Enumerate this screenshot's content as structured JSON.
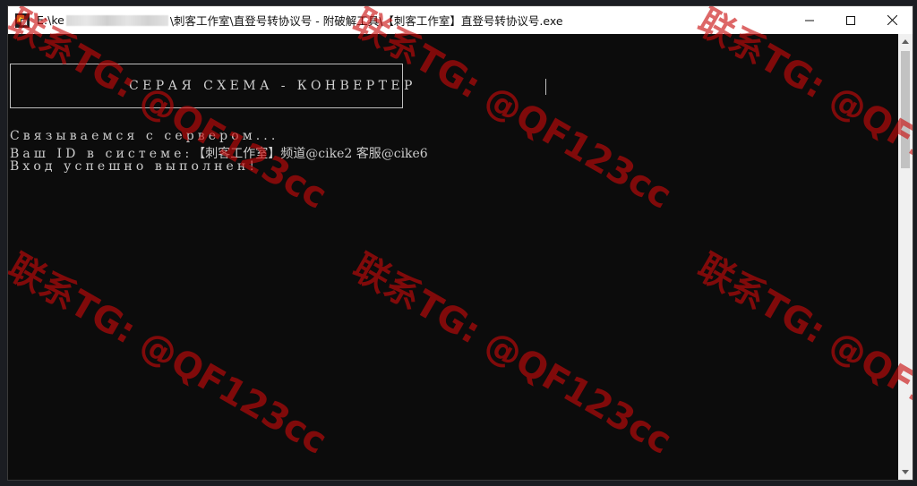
{
  "window": {
    "title_prefix": "E:\\ke",
    "title_suffix": "\\刺客工作室\\直登号转协议号 - 附破解工具\\【刺客工作室】直登号转协议号.exe",
    "controls": {
      "minimize": "minimize-icon",
      "maximize": "maximize-icon",
      "close": "close-icon"
    }
  },
  "console": {
    "banner_title": "СЕРАЯ СХЕМА - КОНВЕРТЕР",
    "lines": {
      "connecting": "Связываемся с сервером...",
      "id_prefix": "Ваш ID в системе:",
      "id_value": "【刺客工作室】频道@cike2 客服@cike6",
      "success": "Вход успешно выполнен!"
    },
    "text_color": "#cccccc",
    "background": "#0c0c0c"
  },
  "watermark": {
    "text": "联系TG: @QF123cc",
    "color": "#c80a0a"
  }
}
